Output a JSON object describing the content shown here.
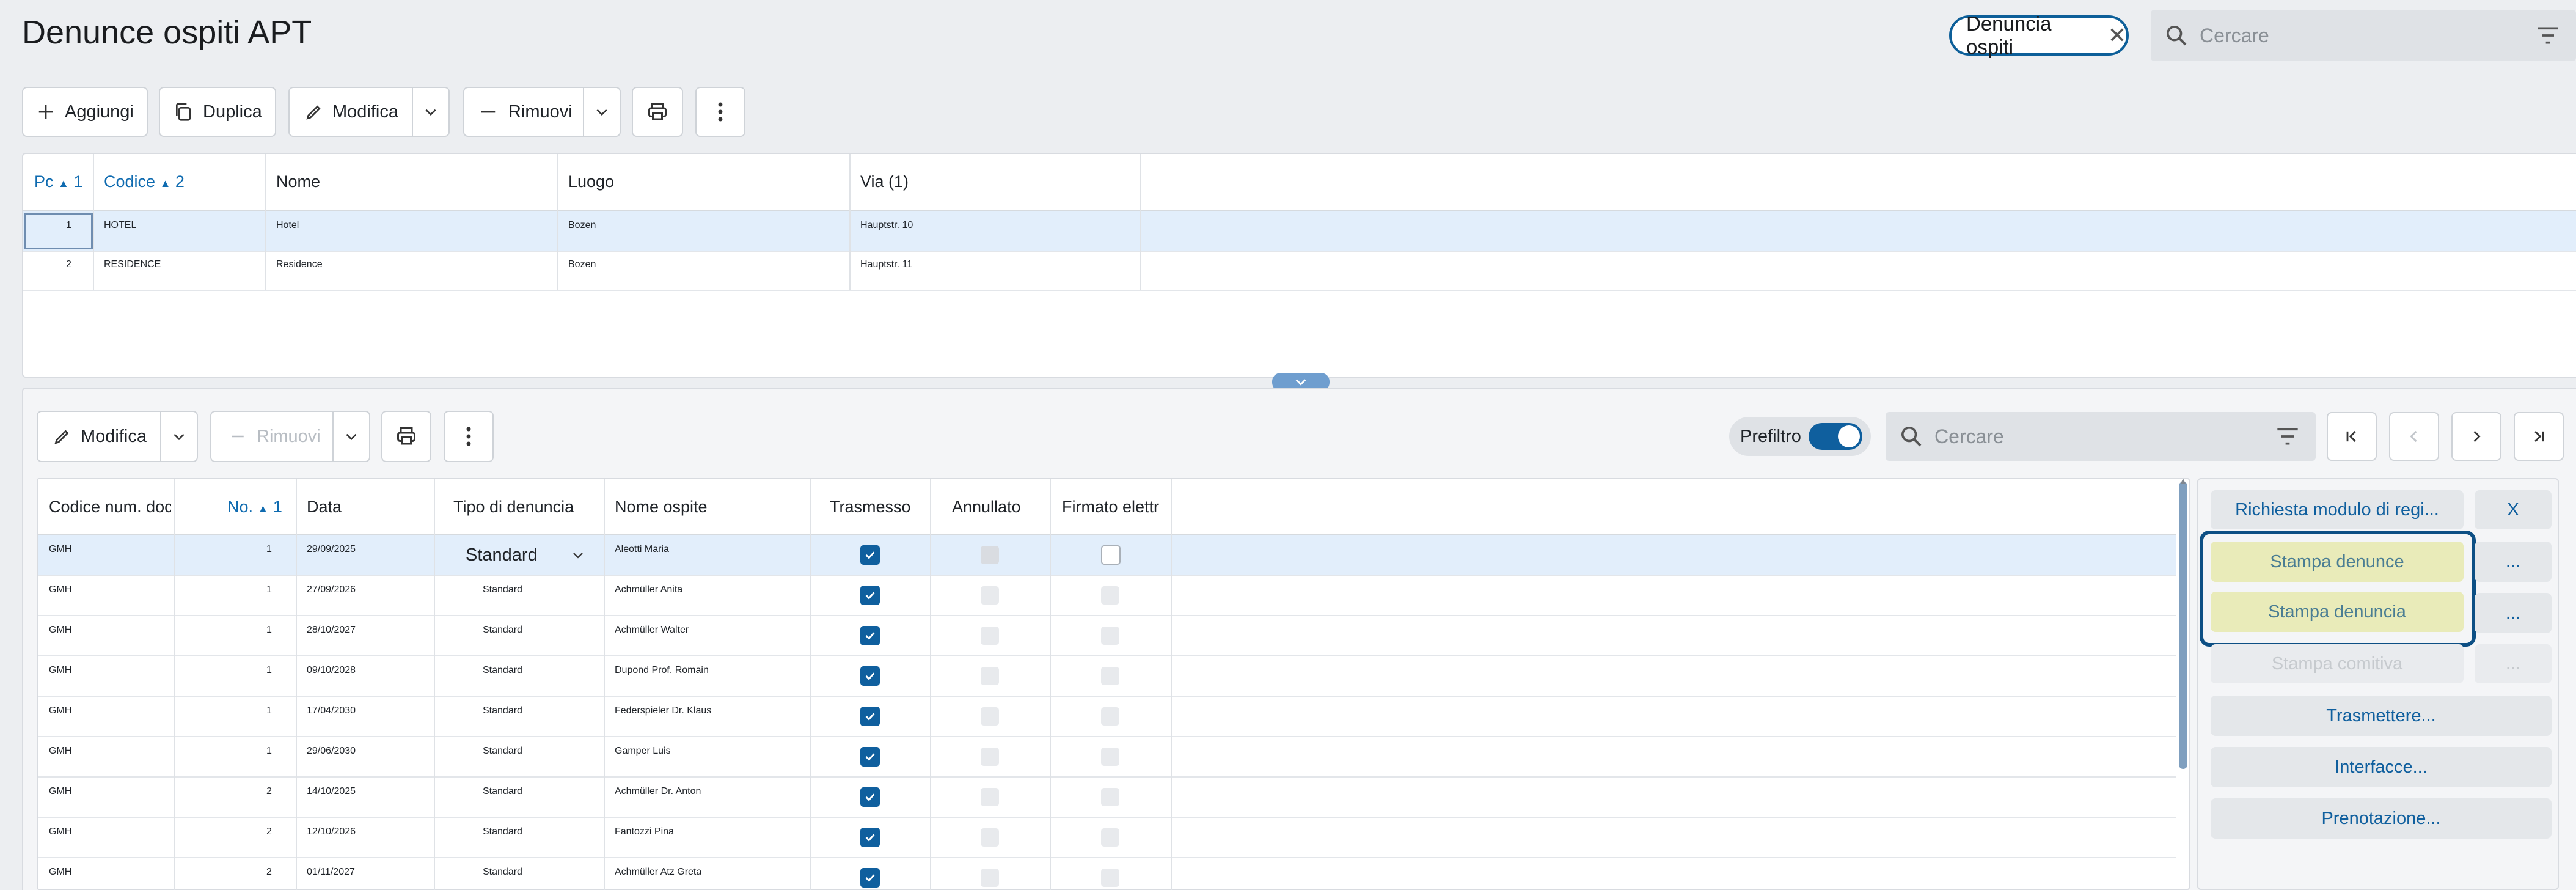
{
  "page": {
    "title": "Denunce ospiti APT"
  },
  "header": {
    "chip_label": "Denuncia ospiti",
    "search_placeholder": "Cercare"
  },
  "top_toolbar": {
    "add": "Aggiungi",
    "duplicate": "Duplica",
    "edit": "Modifica",
    "remove": "Rimuovi"
  },
  "top_table": {
    "columns": [
      "Pc",
      "1",
      "Codice",
      "2",
      "Nome",
      "Luogo",
      "Via (1)"
    ],
    "rows": [
      {
        "pc": "1",
        "codice": "HOTEL",
        "nome": "Hotel",
        "luogo": "Bozen",
        "via": "Hauptstr. 10"
      },
      {
        "pc": "2",
        "codice": "RESIDENCE",
        "nome": "Residence",
        "luogo": "Bozen",
        "via": "Hauptstr. 11"
      }
    ]
  },
  "bottom_toolbar": {
    "edit": "Modifica",
    "remove": "Rimuovi",
    "prefilter": "Prefiltro",
    "search_placeholder": "Cercare"
  },
  "bottom_table": {
    "columns": [
      "Codice num. doc",
      "No.",
      "1",
      "Data",
      "Tipo di denuncia",
      "Nome ospite",
      "Trasmesso",
      "Annullato",
      "Firmato elettr"
    ],
    "rows": [
      {
        "cod": "GMH",
        "no": "1",
        "data": "29/09/2025",
        "tipo": "Standard",
        "nome": "Aleotti Maria",
        "trasmesso": true
      },
      {
        "cod": "GMH",
        "no": "1",
        "data": "27/09/2026",
        "tipo": "Standard",
        "nome": "Achmüller Anita",
        "trasmesso": true
      },
      {
        "cod": "GMH",
        "no": "1",
        "data": "28/10/2027",
        "tipo": "Standard",
        "nome": "Achmüller Walter",
        "trasmesso": true
      },
      {
        "cod": "GMH",
        "no": "1",
        "data": "09/10/2028",
        "tipo": "Standard",
        "nome": "Dupond Prof. Romain",
        "trasmesso": true
      },
      {
        "cod": "GMH",
        "no": "1",
        "data": "17/04/2030",
        "tipo": "Standard",
        "nome": "Federspieler Dr. Klaus",
        "trasmesso": true
      },
      {
        "cod": "GMH",
        "no": "1",
        "data": "29/06/2030",
        "tipo": "Standard",
        "nome": "Gamper Luis",
        "trasmesso": true
      },
      {
        "cod": "GMH",
        "no": "2",
        "data": "14/10/2025",
        "tipo": "Standard",
        "nome": "Achmüller Dr. Anton",
        "trasmesso": true
      },
      {
        "cod": "GMH",
        "no": "2",
        "data": "12/10/2026",
        "tipo": "Standard",
        "nome": "Fantozzi Pina",
        "trasmesso": true
      },
      {
        "cod": "GMH",
        "no": "2",
        "data": "01/11/2027",
        "tipo": "Standard",
        "nome": "Achmüller Atz Greta",
        "trasmesso": true
      }
    ]
  },
  "actions": {
    "richiesta": "Richiesta modulo di regi...",
    "close": "X",
    "stampa_denunce": "Stampa denunce",
    "stampa_denuncia": "Stampa denuncia",
    "stampa_comitiva": "Stampa comitiva",
    "more": "...",
    "trasmettere": "Trasmettere...",
    "interfacce": "Interfacce...",
    "prenotazione": "Prenotazione..."
  },
  "colors": {
    "accent": "#0f5f9e",
    "highlight": "#e9ebb9",
    "selected_row": "#e2eefb"
  }
}
